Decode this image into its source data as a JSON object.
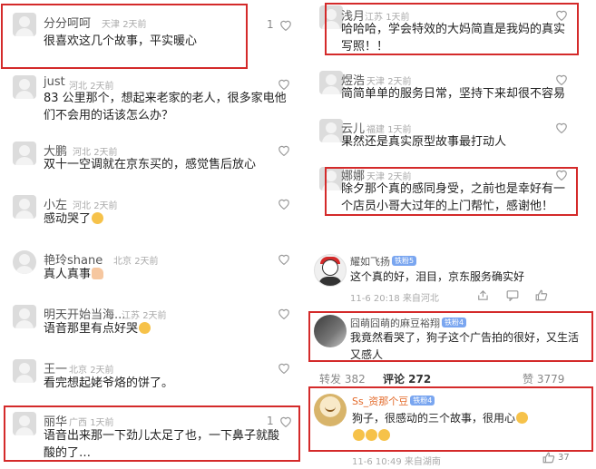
{
  "left": {
    "comments": [
      {
        "name": "分分呵呵",
        "region": "天津",
        "time": "2天前",
        "text": "很喜欢这几个故事，平实暖心",
        "likes": "1"
      },
      {
        "name": "just",
        "region": "河北",
        "time": "2天前",
        "text": "83 公里那个，想起来老家的老人，很多家电他们不会用的话该怎么办？"
      },
      {
        "name": "大鹏",
        "region": "河北",
        "time": "2天前",
        "text": "双十一空调就在京东买的，感觉售后放心"
      },
      {
        "name": "小左",
        "region": "河北",
        "time": "2天前",
        "text": "感动哭了"
      },
      {
        "name": "艳玲shane",
        "region": "北京",
        "time": "2天前",
        "text": "真人真事"
      },
      {
        "name": "明天开始当海...",
        "region": "江苏",
        "time": "2天前",
        "text": "语音那里有点好哭"
      },
      {
        "name": "王一",
        "region": "北京",
        "time": "2天前",
        "text": "看完想起姥爷烙的饼了。"
      },
      {
        "name": "丽华",
        "region": "广西",
        "time": "1天前",
        "text": "语音出来那一下劲儿太足了也，一下鼻子就酸酸的了…",
        "likes": "1"
      }
    ]
  },
  "right": {
    "comments": [
      {
        "name": "浅月",
        "region": "江苏",
        "time": "1天前",
        "text": "哈哈哈，学会特效的大妈简直是我妈的真实写照！！"
      },
      {
        "name": "煜浩",
        "region": "天津",
        "time": "2天前",
        "text": "简简单单的服务日常，坚持下来却很不容易"
      },
      {
        "name": "云儿",
        "region": "福建",
        "time": "1天前",
        "text": "果然还是真实原型故事最打动人"
      },
      {
        "name": "娜娜",
        "region": "天津",
        "time": "2天前",
        "text": "除夕那个真的感同身受，之前也是幸好有一个店员小哥大过年的上门帮忙，感谢他！"
      }
    ],
    "weibo": [
      {
        "name": "耀如飞扬",
        "badge": "铁粉5",
        "text": "这个真的好，泪目，京东服务确实好",
        "time": "11-6 20:18",
        "source": "来自河北"
      },
      {
        "name": "囧萌囧萌的麻豆裕翔",
        "badge": "铁粉4",
        "text": "我竟然看哭了，狗子这个广告拍的很好，又生活又感人"
      },
      {
        "name": "Ss_资那个豆",
        "badge": "铁粉4",
        "text": "狗子，很感动的三个故事，很用心",
        "time": "11-6 10:49",
        "source": "来自湖南",
        "likes": "37"
      }
    ],
    "stats_bar": {
      "repost": "转发 382",
      "comments": "评论 272",
      "likes": "赞 3779"
    }
  },
  "colors": {
    "highlight_box": "#d42a2a",
    "badge": "#7aa6f0"
  },
  "icons": [
    "heart-icon",
    "share-icon",
    "comment-icon",
    "thumb-up-icon",
    "avatar-placeholder"
  ]
}
